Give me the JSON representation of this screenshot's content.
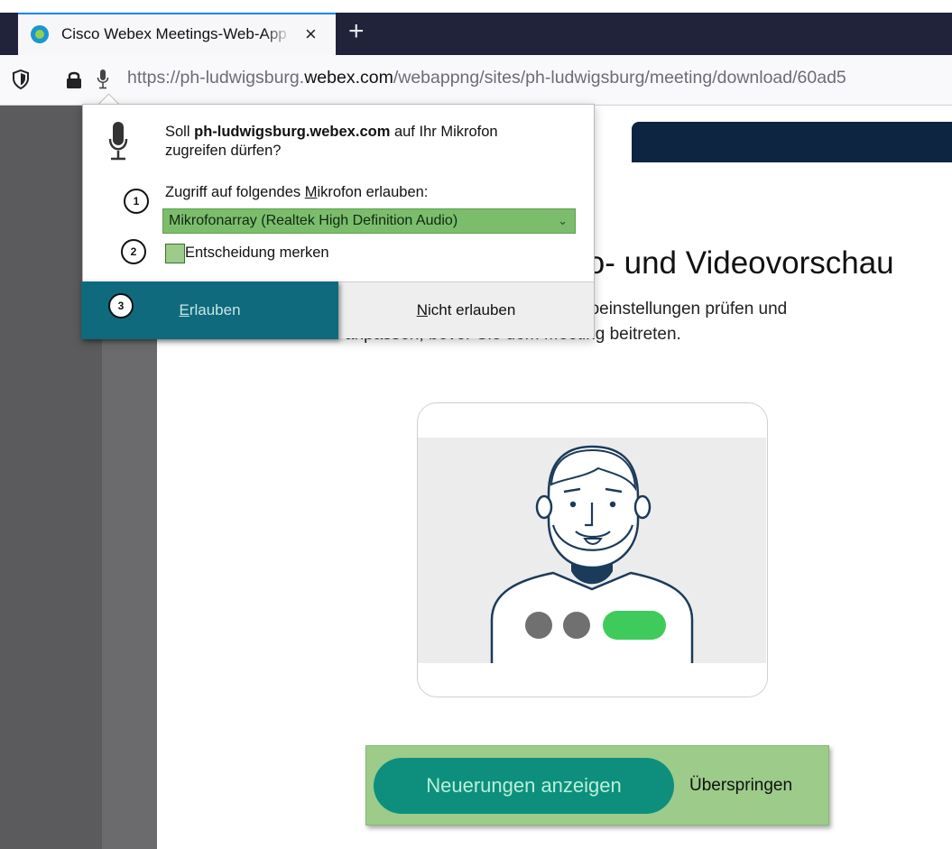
{
  "browser": {
    "tab_title": "Cisco Webex Meetings-Web-App",
    "tab_close": "×",
    "new_tab": "+",
    "url_prefix": "https://ph-ludwigsburg.",
    "url_domain": "webex.com",
    "url_suffix": "/webappng/sites/ph-ludwigsburg/meeting/download/60ad5"
  },
  "permission_popup": {
    "question_prefix": "Soll ",
    "question_host": "ph-ludwigsburg.webex.com",
    "question_suffix": " auf Ihr Mikrofon zugreifen dürfen?",
    "access_label_pre": "Zugriff auf folgendes ",
    "access_label_u": "M",
    "access_label_post": "ikrofon erlauben:",
    "microphone_selected": "Mikrofonarray (Realtek High Definition Audio)",
    "remember_label": "Entscheidung merken",
    "allow_u": "E",
    "allow_rest": "rlauben",
    "deny_u": "N",
    "deny_rest": "icht erlauben",
    "callouts": [
      "1",
      "2",
      "3"
    ]
  },
  "page": {
    "heading": "io- und Videovorschau",
    "description_line1": "eoeinstellungen prüfen und",
    "description_line2": "anpassen, bevor Sie dem Meeting beitreten.",
    "primary_button": "Neuerungen anzeigen",
    "skip_button": "Überspringen"
  },
  "colors": {
    "highlight_green": "#9ccb8a",
    "teal_button": "#0e8f7e",
    "allow_button": "#0e6a7c",
    "tabbar": "#20233a"
  }
}
